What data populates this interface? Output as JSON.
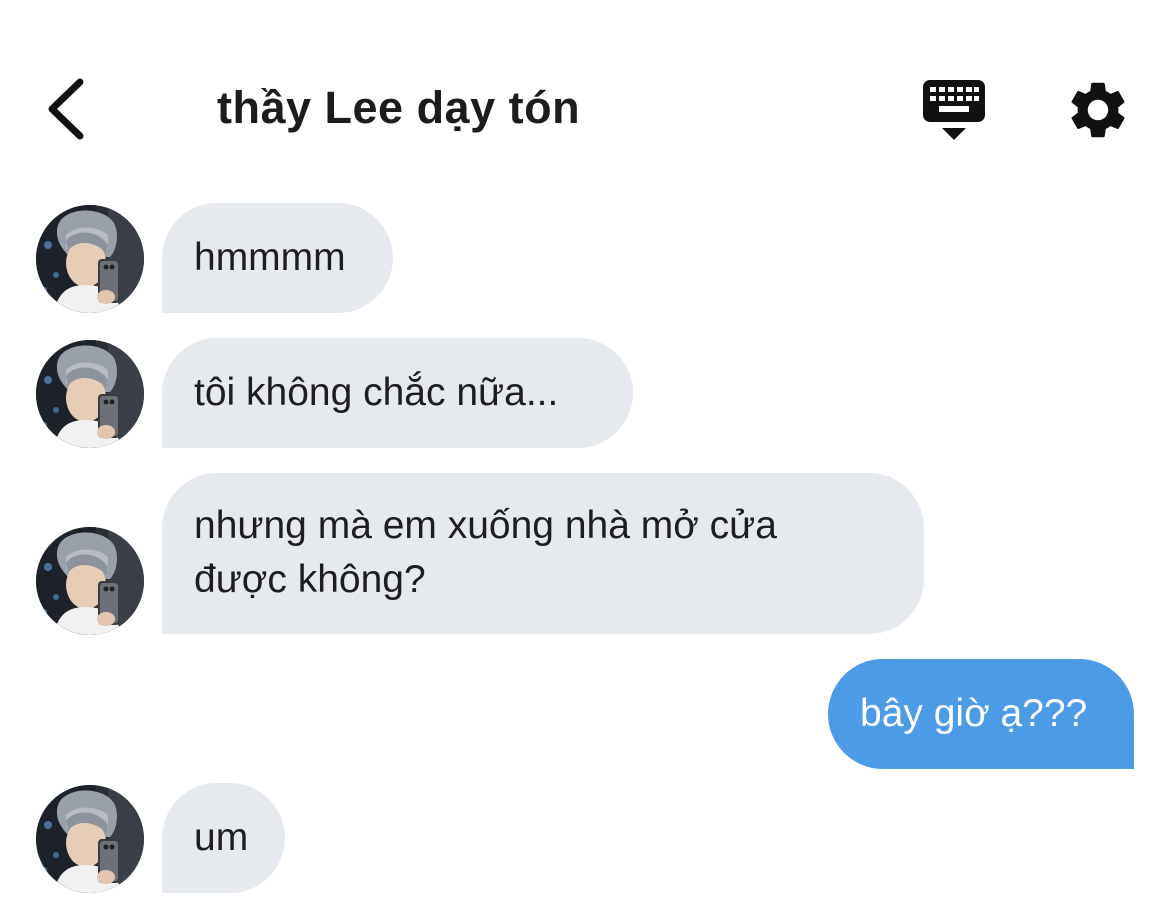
{
  "header": {
    "title": "thầy Lee dạy tón",
    "back_icon": "chevron-left-icon",
    "keyboard_icon": "keyboard-icon",
    "settings_icon": "gear-icon"
  },
  "colors": {
    "incoming_bubble": "#e6e9ee",
    "outgoing_bubble": "#4b9be6",
    "text": "#1e1e1e"
  },
  "messages": [
    {
      "from": "contact",
      "text": "hmmmm"
    },
    {
      "from": "contact",
      "text": "tôi không chắc nữa..."
    },
    {
      "from": "contact",
      "line1": "nhưng mà em xuống nhà mở cửa",
      "line2": "được không?"
    },
    {
      "from": "me",
      "text": "bây giờ ạ???"
    },
    {
      "from": "contact",
      "text": "um"
    }
  ]
}
